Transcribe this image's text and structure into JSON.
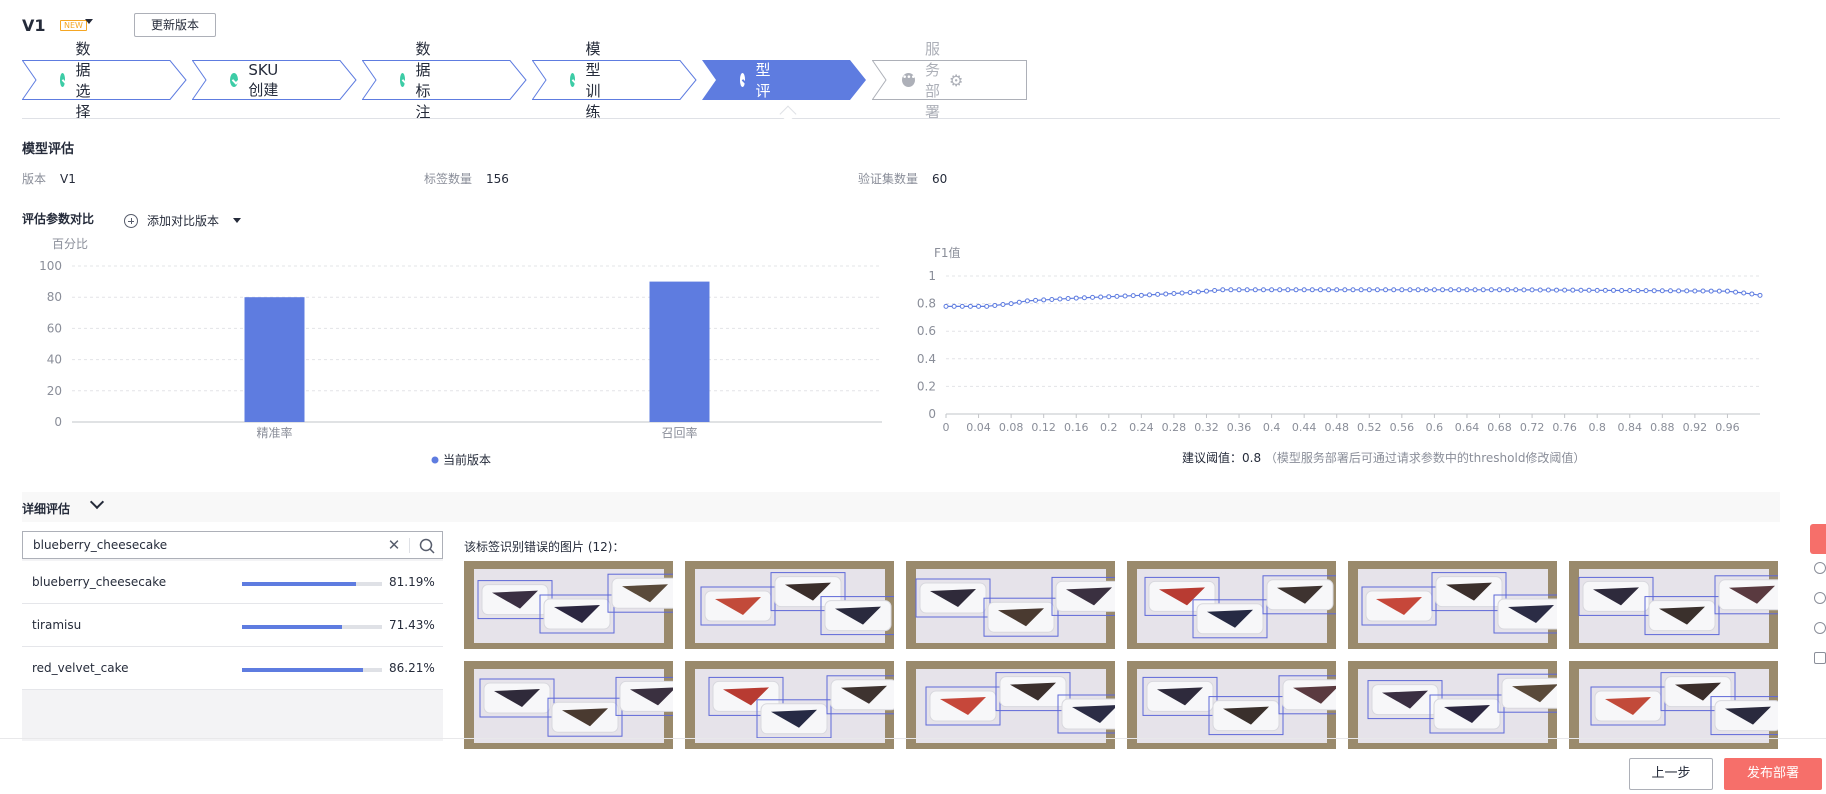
{
  "header": {
    "version": "V1",
    "new_badge": "NEW",
    "update_button": "更新版本"
  },
  "steps": [
    {
      "label": "数据选择",
      "state": "done"
    },
    {
      "label": "SKU创建",
      "state": "done"
    },
    {
      "label": "数据标注",
      "state": "done"
    },
    {
      "label": "模型训练",
      "state": "done"
    },
    {
      "label": "模型评估",
      "state": "active"
    },
    {
      "label": "服务部署",
      "state": "pending"
    }
  ],
  "summary": {
    "title": "模型评估",
    "version_label": "版本",
    "version_value": "V1",
    "labels_label": "标签数量",
    "labels_value": "156",
    "validation_label": "验证集数量",
    "validation_value": "60"
  },
  "compare": {
    "title": "评估参数对比",
    "add_label": "添加对比版本"
  },
  "colors": {
    "primary": "#5e7ce0",
    "success": "#3dcca6",
    "danger": "#f66f6a"
  },
  "chart_data": [
    {
      "type": "bar",
      "ylabel": "百分比",
      "categories": [
        "精准率",
        "召回率"
      ],
      "series": [
        {
          "name": "当前版本",
          "values": [
            80,
            90
          ]
        }
      ],
      "ylim": [
        0,
        100
      ],
      "yticks": [
        "100",
        "80",
        "60",
        "40",
        "20",
        "0"
      ],
      "legend": "bottom-center",
      "grid": true
    },
    {
      "type": "line",
      "ylabel": "F1值",
      "xlim": [
        0,
        1
      ],
      "ylim": [
        0,
        1
      ],
      "xticks": [
        "0",
        "0.04",
        "0.08",
        "0.12",
        "0.16",
        "0.2",
        "0.24",
        "0.28",
        "0.32",
        "0.36",
        "0.4",
        "0.44",
        "0.48",
        "0.52",
        "0.56",
        "0.6",
        "0.64",
        "0.68",
        "0.72",
        "0.76",
        "0.8",
        "0.84",
        "0.88",
        "0.92",
        "0.96"
      ],
      "yticks": [
        "1",
        "0.8",
        "0.6",
        "0.4",
        "0.2",
        "0"
      ],
      "anchors": [
        [
          0,
          0.78
        ],
        [
          0.05,
          0.78
        ],
        [
          0.08,
          0.8
        ],
        [
          0.1,
          0.82
        ],
        [
          0.16,
          0.84
        ],
        [
          0.2,
          0.85
        ],
        [
          0.24,
          0.86
        ],
        [
          0.3,
          0.88
        ],
        [
          0.34,
          0.9
        ],
        [
          0.56,
          0.9
        ],
        [
          0.7,
          0.9
        ],
        [
          0.96,
          0.89
        ],
        [
          0.99,
          0.87
        ],
        [
          1,
          0.86
        ]
      ],
      "note_prefix": "建议阈值：0.8",
      "note_rest": "（模型服务部署后可通过请求参数中的threshold修改阈值）",
      "grid": true
    }
  ],
  "detail": {
    "title": "详细评估",
    "search_value": "blueberry_cheesecake",
    "classes": [
      {
        "name": "blueberry_cheesecake",
        "ratio": 0.8119,
        "percent": "81.19%"
      },
      {
        "name": "tiramisu",
        "ratio": 0.7143,
        "percent": "71.43%"
      },
      {
        "name": "red_velvet_cake",
        "ratio": 0.8621,
        "percent": "86.21%"
      }
    ],
    "wrong_images_label": "该标签识别错误的图片 (12)："
  },
  "footer": {
    "prev_button": "上一步",
    "deploy_button": "发布部署"
  }
}
